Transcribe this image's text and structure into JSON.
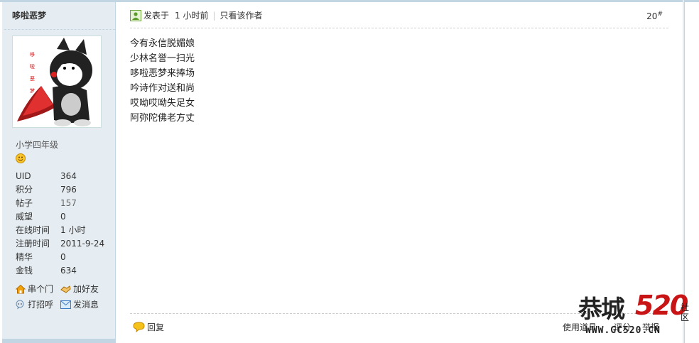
{
  "sidebar": {
    "author": "哆啦恶梦",
    "grade": "小学四年级",
    "stats": [
      {
        "key": "UID",
        "value": "364",
        "link": false
      },
      {
        "key": "积分",
        "value": "796",
        "link": false
      },
      {
        "key": "帖子",
        "value": "157",
        "link": true
      },
      {
        "key": "威望",
        "value": "0",
        "link": false
      },
      {
        "key": "在线时间",
        "value": "1 小时",
        "link": false
      },
      {
        "key": "注册时间",
        "value": "2011-9-24",
        "link": false
      },
      {
        "key": "精华",
        "value": "0",
        "link": false
      },
      {
        "key": "金钱",
        "value": "634",
        "link": false
      }
    ],
    "actions": {
      "visit": "串个门",
      "add_friend": "加好友",
      "greet": "打招呼",
      "message": "发消息"
    }
  },
  "post": {
    "posted_label": "发表于",
    "time": "1 小时前",
    "author_only": "只看该作者",
    "floor": "20",
    "floor_mark": "#",
    "lines": [
      "今有永信脱媚娘",
      "少林名誉一扫光",
      "哆啦恶梦来捧场",
      "吟诗作对送和尚",
      "哎呦哎呦失足女",
      "阿弥陀佛老方丈"
    ]
  },
  "footer": {
    "reply": "回复",
    "use_item": "使用道具",
    "rate": "评分",
    "report": "举报"
  },
  "watermark": {
    "logo_cn": "恭城",
    "logo_num": "520",
    "logo_tag": "社区",
    "url": "WWW.GC520.CN"
  },
  "colors": {
    "accent": "#c2d5e3",
    "sidebar_bg": "#e5edf2",
    "brand_red": "#c81414"
  }
}
